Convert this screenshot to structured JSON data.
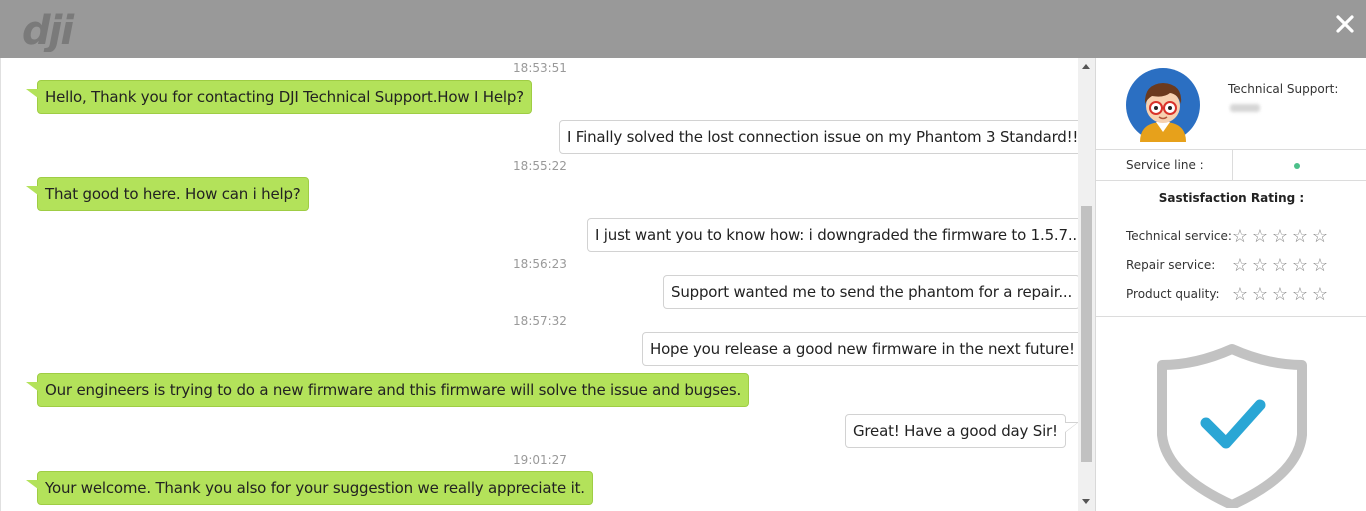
{
  "header": {
    "logo_text": "dji",
    "close_icon": "close-icon",
    "background": "#999999"
  },
  "chat": {
    "timestamps": [
      "18:53:51",
      "18:55:22",
      "18:56:23",
      "18:57:32",
      "19:01:27"
    ],
    "messages": [
      {
        "from": "agent",
        "text": "Hello, Thank you for contacting DJI Technical Support.How I Help?"
      },
      {
        "from": "user",
        "text": "I Finally solved the lost connection issue on my Phantom 3 Standard!!!"
      },
      {
        "from": "agent",
        "text": "That good to here. How can i help?"
      },
      {
        "from": "user",
        "text": "I just want you to know how: i downgraded the firmware to 1.5.7..."
      },
      {
        "from": "user",
        "text": "Support wanted me to send the phantom for a repair..."
      },
      {
        "from": "user",
        "text": "Hope you release a good new firmware in the next future!"
      },
      {
        "from": "agent",
        "text": "Our engineers is trying to do a new firmware and this firmware will solve the issue and bugses."
      },
      {
        "from": "user",
        "text": "Great! Have a good day Sir!"
      },
      {
        "from": "agent",
        "text": "Your welcome. Thank you also for your suggestion we really appreciate it."
      }
    ],
    "colors": {
      "agent_bubble": "#b3e25a",
      "user_bubble": "#ffffff"
    }
  },
  "side": {
    "support_label": "Technical Support:",
    "service_line_label": "Service line :",
    "service_status_color": "#4cc08a",
    "rating_title": "Sastisfaction Rating :",
    "ratings": [
      {
        "label": "Technical service:",
        "stars": 0,
        "max": 5
      },
      {
        "label": "Repair service:",
        "stars": 0,
        "max": 5
      },
      {
        "label": "Product quality:",
        "stars": 0,
        "max": 5
      }
    ],
    "star_glyph": "☆",
    "shield_icon": "shield-check-icon",
    "check_color": "#2aa6d5"
  }
}
